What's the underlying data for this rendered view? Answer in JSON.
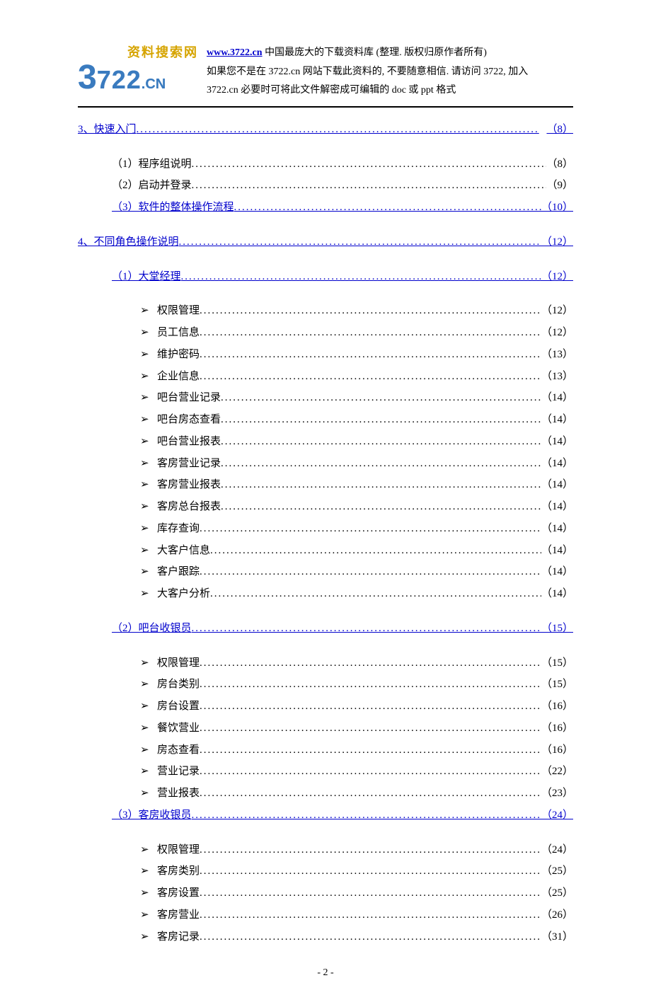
{
  "header": {
    "logo_top": "资料搜索网",
    "url": "www.3722.cn",
    "line1_rest": " 中国最庞大的下载资料库 (整理. 版权归原作者所有)",
    "line2": "如果您不是在 3722.cn 网站下载此资料的, 不要随意相信. 请访问 3722, 加入",
    "line3": "3722.cn 必要时可将此文件解密成可编辑的 doc 或 ppt 格式"
  },
  "toc": [
    {
      "type": "line",
      "indent": 0,
      "link": true,
      "text": "3、快速入门",
      "page": "（8）"
    },
    {
      "type": "gap"
    },
    {
      "type": "line",
      "indent": 1,
      "link": false,
      "text": "（1）程序组说明",
      "page": "（8）"
    },
    {
      "type": "line",
      "indent": 1,
      "link": false,
      "text": "（2）启动并登录",
      "page": "（9）"
    },
    {
      "type": "line",
      "indent": 1,
      "link": true,
      "text": "（3）软件的整体操作流程",
      "page": "（10）"
    },
    {
      "type": "gap"
    },
    {
      "type": "line",
      "indent": 0,
      "link": true,
      "text": "4、不同角色操作说明",
      "page": "（12）"
    },
    {
      "type": "gap"
    },
    {
      "type": "line",
      "indent": 1,
      "link": true,
      "text": "（1）大堂经理",
      "page": "（12）"
    },
    {
      "type": "gap"
    },
    {
      "type": "line",
      "indent": 2,
      "link": false,
      "bullet": true,
      "text": "权限管理 ",
      "page": "（12）"
    },
    {
      "type": "line",
      "indent": 2,
      "link": false,
      "bullet": true,
      "text": "员工信息 ",
      "page": "（12）"
    },
    {
      "type": "line",
      "indent": 2,
      "link": false,
      "bullet": true,
      "text": "维护密码 ",
      "page": "（13）"
    },
    {
      "type": "line",
      "indent": 2,
      "link": false,
      "bullet": true,
      "text": "企业信息 ",
      "page": "（13）"
    },
    {
      "type": "line",
      "indent": 2,
      "link": false,
      "bullet": true,
      "text": "吧台营业记录 ",
      "page": "（14）"
    },
    {
      "type": "line",
      "indent": 2,
      "link": false,
      "bullet": true,
      "text": "吧台房态查看 ",
      "page": "（14）"
    },
    {
      "type": "line",
      "indent": 2,
      "link": false,
      "bullet": true,
      "text": "吧台营业报表 ",
      "page": "（14）"
    },
    {
      "type": "line",
      "indent": 2,
      "link": false,
      "bullet": true,
      "text": "客房营业记录 ",
      "page": "（14）"
    },
    {
      "type": "line",
      "indent": 2,
      "link": false,
      "bullet": true,
      "text": "客房营业报表 ",
      "page": "（14）"
    },
    {
      "type": "line",
      "indent": 2,
      "link": false,
      "bullet": true,
      "text": "客房总台报表 ",
      "page": "（14）"
    },
    {
      "type": "line",
      "indent": 2,
      "link": false,
      "bullet": true,
      "text": "库存查询 ",
      "page": "（14）"
    },
    {
      "type": "line",
      "indent": 2,
      "link": false,
      "bullet": true,
      "text": "大客户信息 ",
      "page": "（14）"
    },
    {
      "type": "line",
      "indent": 2,
      "link": false,
      "bullet": true,
      "text": "客户跟踪 ",
      "page": "（14）"
    },
    {
      "type": "line",
      "indent": 2,
      "link": false,
      "bullet": true,
      "text": "大客户分析 ",
      "page": "（14）"
    },
    {
      "type": "gap"
    },
    {
      "type": "line",
      "indent": 1,
      "link": true,
      "text": "（2）吧台收银员",
      "page": "（15）"
    },
    {
      "type": "gap"
    },
    {
      "type": "line",
      "indent": 2,
      "link": false,
      "bullet": true,
      "text": "权限管理 ",
      "page": "（15）"
    },
    {
      "type": "line",
      "indent": 2,
      "link": false,
      "bullet": true,
      "text": "房台类别 ",
      "page": "（15）"
    },
    {
      "type": "line",
      "indent": 2,
      "link": false,
      "bullet": true,
      "text": "房台设置 ",
      "page": "（16）"
    },
    {
      "type": "line",
      "indent": 2,
      "link": false,
      "bullet": true,
      "text": "餐饮营业 ",
      "page": "（16）"
    },
    {
      "type": "line",
      "indent": 2,
      "link": false,
      "bullet": true,
      "text": "房态查看 ",
      "page": "（16）"
    },
    {
      "type": "line",
      "indent": 2,
      "link": false,
      "bullet": true,
      "text": "营业记录 ",
      "page": "（22）"
    },
    {
      "type": "line",
      "indent": 2,
      "link": false,
      "bullet": true,
      "text": "营业报表 ",
      "page": "（23）"
    },
    {
      "type": "line",
      "indent": 1,
      "link": true,
      "text": "（3）客房收银员",
      "page": "（24）"
    },
    {
      "type": "gap"
    },
    {
      "type": "line",
      "indent": 2,
      "link": false,
      "bullet": true,
      "text": "权限管理 ",
      "page": "（24）"
    },
    {
      "type": "line",
      "indent": 2,
      "link": false,
      "bullet": true,
      "text": "客房类别 ",
      "page": "（25）"
    },
    {
      "type": "line",
      "indent": 2,
      "link": false,
      "bullet": true,
      "text": "客房设置 ",
      "page": "（25）"
    },
    {
      "type": "line",
      "indent": 2,
      "link": false,
      "bullet": true,
      "text": "客房营业 ",
      "page": "（26）"
    },
    {
      "type": "line",
      "indent": 2,
      "link": false,
      "bullet": true,
      "text": "客房记录 ",
      "page": "（31）"
    }
  ],
  "footer": "- 2 -"
}
